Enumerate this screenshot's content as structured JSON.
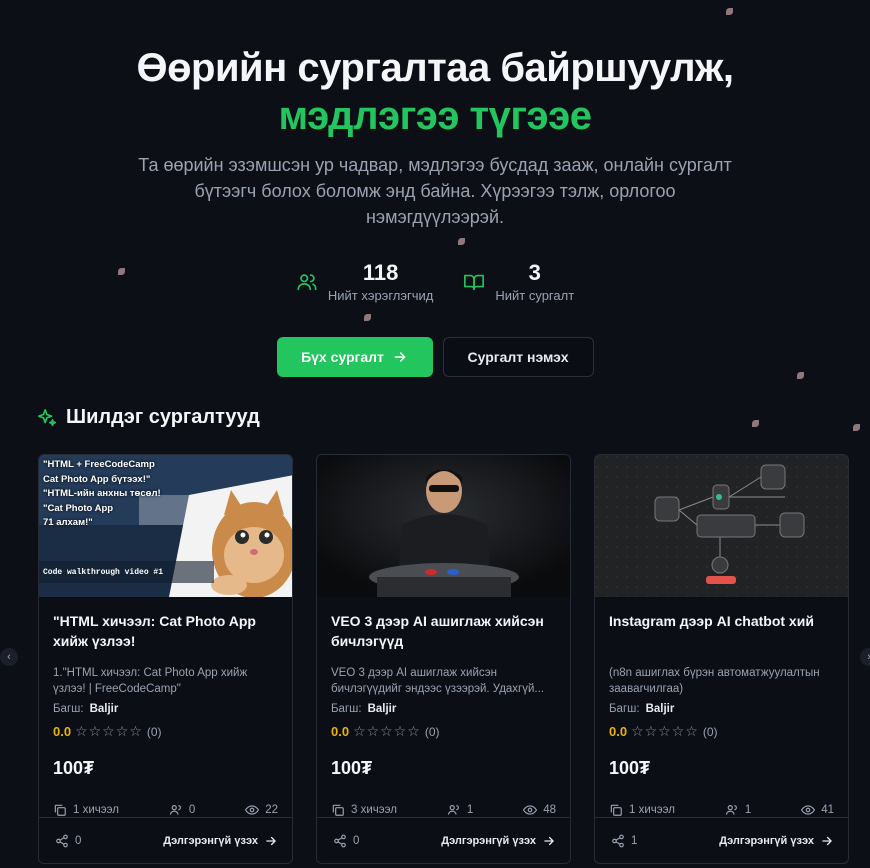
{
  "hero": {
    "title_line1": "Өөрийн сургалтаа байршуулж,",
    "title_line2": "мэдлэгээ түгээе",
    "subtitle": "Та өөрийн эзэмшсэн ур чадвар, мэдлэгээ бусдад зааж, онлайн сургалт бүтээгч болох боломж энд байна. Хүрээгээ тэлж, орлогоо нэмэгдүүлээрэй."
  },
  "stats": [
    {
      "icon": "users-icon",
      "value": "118",
      "label": "Нийт хэрэглэгчид"
    },
    {
      "icon": "book-icon",
      "value": "3",
      "label": "Нийт сургалт"
    }
  ],
  "actions": {
    "primary_label": "Бүх сургалт",
    "secondary_label": "Сургалт нэмэх"
  },
  "section": {
    "title": "Шилдэг сургалтууд"
  },
  "courses": [
    {
      "title": "\"HTML хичээл: Cat Photo App хийж үзлээ!",
      "desc": "1.\"HTML хичээл: Cat Photo App хийж үзлээ! | FreeCodeCamp\"",
      "teacher_label": "Багш:",
      "teacher": "Baljir",
      "rating": "0.0",
      "rating_count": "(0)",
      "price": "100₮",
      "lessons": "1 хичээл",
      "students": "0",
      "views": "22",
      "shares": "0",
      "more": "Дэлгэрэнгүй үзэх",
      "thumb_lines": [
        "\"HTML + FreeCodeCamp",
        "Cat Photo App бүтээх!\"",
        "\"HTML-ийн анхны төсөл!",
        "\"Cat Photo App",
        "71 алхам!\""
      ],
      "thumb_caption": "Code walkthrough video #1"
    },
    {
      "title": "VEO 3 дээр AI ашиглаж хийсэн бичлэгүүд",
      "desc": "VEO 3 дээр AI ашиглаж хийсэн бичлэгүүдийг эндээс үзээрэй. Удахгүй...",
      "teacher_label": "Багш:",
      "teacher": "Baljir",
      "rating": "0.0",
      "rating_count": "(0)",
      "price": "100₮",
      "lessons": "3 хичээл",
      "students": "1",
      "views": "48",
      "shares": "0",
      "more": "Дэлгэрэнгүй үзэх"
    },
    {
      "title": "Instagram дээр AI chatbot хий",
      "desc": "(n8n ашиглах бүрэн автоматжуулалтын заавarчилгаа)",
      "teacher_label": "Багш:",
      "teacher": "Baljir",
      "rating": "0.0",
      "rating_count": "(0)",
      "price": "100₮",
      "lessons": "1 хичээл",
      "students": "1",
      "views": "41",
      "shares": "1",
      "more": "Дэлгэрэнгүй үзэх"
    }
  ],
  "colors": {
    "accent": "#22c55e",
    "background": "#0c0f16",
    "rating": "#eab308"
  }
}
